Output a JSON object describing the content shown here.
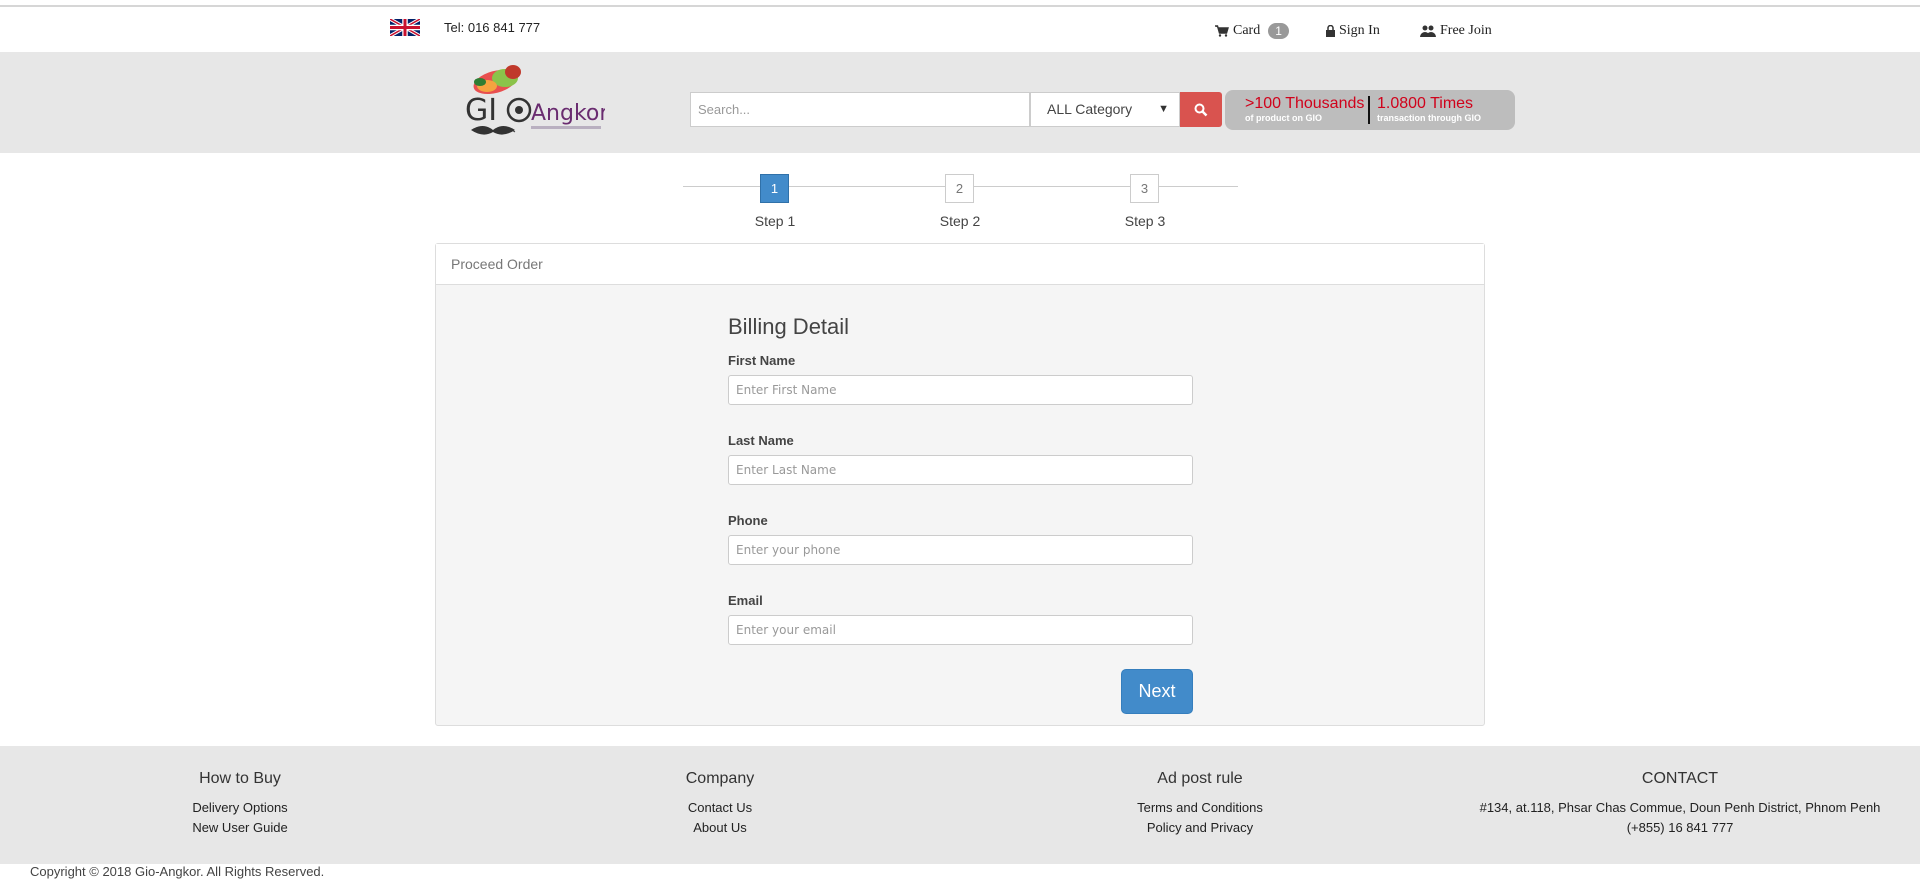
{
  "topbar": {
    "tel": "Tel: 016 841 777",
    "cart_label": "Card",
    "cart_count": "1",
    "signin_label": "Sign In",
    "join_label": "Free Join"
  },
  "header": {
    "logo_text": "GIO Angkor",
    "search_placeholder": "Search...",
    "category_selected": "ALL Category",
    "promo": {
      "left_big": ">100 Thousands",
      "left_small": "of product on GIO",
      "right_big": "1.0800 Times",
      "right_small": "transaction through GIO"
    }
  },
  "steps": [
    {
      "number": "1",
      "label": "Step 1",
      "active": true
    },
    {
      "number": "2",
      "label": "Step 2",
      "active": false
    },
    {
      "number": "3",
      "label": "Step 3",
      "active": false
    }
  ],
  "panel": {
    "heading": "Proceed Order",
    "form_title": "Billing Detail",
    "fields": [
      {
        "label": "First Name",
        "placeholder": "Enter First Name"
      },
      {
        "label": "Last Name",
        "placeholder": "Enter Last Name"
      },
      {
        "label": "Phone",
        "placeholder": "Enter your phone"
      },
      {
        "label": "Email",
        "placeholder": "Enter your email"
      }
    ],
    "next_label": "Next"
  },
  "footer": {
    "columns": [
      {
        "heading": "How to Buy",
        "links": [
          "Delivery Options",
          "New User Guide"
        ]
      },
      {
        "heading": "Company",
        "links": [
          "Contact Us",
          "About Us"
        ]
      },
      {
        "heading": "Ad post rule",
        "links": [
          "Terms and Conditions",
          "Policy and Privacy"
        ]
      },
      {
        "heading": "CONTACT",
        "links": [
          "#134, at.118, Phsar Chas Commue, Doun Penh District, Phnom Penh",
          "(+855) 16 841 777"
        ]
      }
    ],
    "copyright": "Copyright © 2018 Gio-Angkor. All Rights Reserved."
  },
  "colors": {
    "primary": "#428bca",
    "danger": "#d9534f",
    "promo_text": "#d0021b",
    "header_bg": "#e7e7e7"
  }
}
